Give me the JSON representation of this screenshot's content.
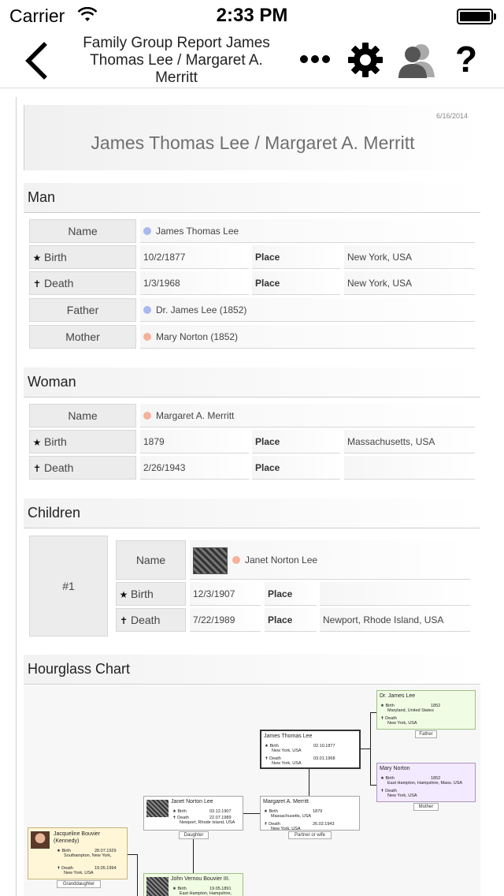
{
  "status": {
    "carrier": "Carrier",
    "time": "2:33 PM"
  },
  "nav": {
    "title": "Family Group Report James Thomas Lee / Margaret A. Merritt",
    "help": "?"
  },
  "report": {
    "date": "6/16/2014",
    "title": "James Thomas Lee / Margaret A. Merritt"
  },
  "man": {
    "heading": "Man",
    "name_label": "Name",
    "name": "James Thomas Lee",
    "birth_label": "Birth",
    "birth_date": "10/2/1877",
    "birth_place_label": "Place",
    "birth_place": "New York, USA",
    "death_label": "Death",
    "death_date": "1/3/1968",
    "death_place_label": "Place",
    "death_place": "New York, USA",
    "father_label": "Father",
    "father": "Dr. James Lee  (1852)",
    "mother_label": "Mother",
    "mother": "Mary Norton  (1852)"
  },
  "woman": {
    "heading": "Woman",
    "name_label": "Name",
    "name": "Margaret A. Merritt",
    "birth_label": "Birth",
    "birth_date": "1879",
    "birth_place_label": "Place",
    "birth_place": "Massachusetts, USA",
    "death_label": "Death",
    "death_date": "2/26/1943",
    "death_place_label": "Place",
    "death_place": ""
  },
  "children": {
    "heading": "Children",
    "items": [
      {
        "number": "#1",
        "name_label": "Name",
        "name": "Janet Norton Lee",
        "birth_label": "Birth",
        "birth_date": "12/3/1907",
        "birth_place_label": "Place",
        "birth_place": "",
        "death_label": "Death",
        "death_date": "7/22/1989",
        "death_place_label": "Place",
        "death_place": "Newport, Rhode Island, USA"
      }
    ]
  },
  "hourglass": {
    "heading": "Hourglass Chart",
    "father": {
      "name": "Dr. James Lee",
      "birth": "1852",
      "birth_place": "Maryland, United States",
      "death_place": "New York, USA",
      "role": "Father"
    },
    "mother": {
      "name": "Mary Norton",
      "birth": "1852",
      "birth_place": "East Hampton, Hampshire, Mass. USA",
      "death_place": "New York, USA",
      "role": "Mother"
    },
    "self": {
      "name": "James Thomas Lee",
      "birth": "02.10.1877",
      "birth_place": "New York, USA",
      "death": "03.01.1968",
      "death_place": "New York, USA"
    },
    "partner": {
      "name": "Margaret A. Merritt",
      "birth": "1879",
      "birth_place": "Massachusetts, USA",
      "death": "26.02.1943",
      "death_place": "New York, USA",
      "role": "Partner or wife"
    },
    "daughter": {
      "name": "Janet Norton Lee",
      "birth": "03.12.1907",
      "death": "22.07.1989",
      "death_place": "Newport, Rhode Island, USA",
      "role": "Daughter"
    },
    "granddaughter": {
      "name": "Jacqueline Bouvier (Kennedy)",
      "birth": "28.07.1929",
      "birth_place": "Southampton, New York,",
      "death": "19.05.1994",
      "death_place": "New York, USA",
      "role": "Granddaughter"
    },
    "son_in_law": {
      "name": "John Vernou Bouvier III.",
      "birth": "19.05.1891",
      "birth_place": "East Hampton, Hampshire,"
    }
  }
}
